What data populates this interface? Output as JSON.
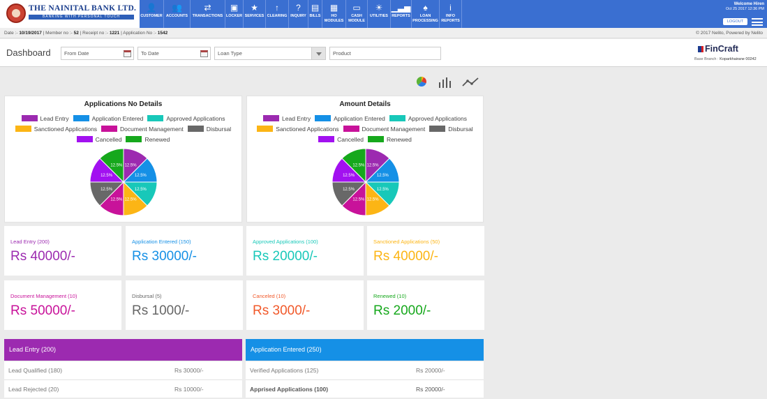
{
  "bank": {
    "name": "THE NAINITAL BANK LTD.",
    "tagline": "BANKING WITH PERSONAL TOUCH"
  },
  "nav": [
    {
      "icon": "user-icon",
      "glyph": "👤",
      "label": "CUSTOMER"
    },
    {
      "icon": "accounts-icon",
      "glyph": "👥",
      "label": "ACCOUNTS"
    },
    {
      "icon": "transfer-icon",
      "glyph": "⇄",
      "label": "TRANSACTIONS"
    },
    {
      "icon": "locker-icon",
      "glyph": "▣",
      "label": "LOCKER"
    },
    {
      "icon": "star-icon",
      "glyph": "★",
      "label": "SERVICES"
    },
    {
      "icon": "arrow-up-icon",
      "glyph": "↑",
      "label": "CLEARING"
    },
    {
      "icon": "question-icon",
      "glyph": "?",
      "label": "INQUIRY"
    },
    {
      "icon": "document-icon",
      "glyph": "▤",
      "label": "BILLS"
    },
    {
      "icon": "ho-modules-icon",
      "glyph": "▦",
      "label": "HO\nMODULES"
    },
    {
      "icon": "cash-icon",
      "glyph": "▭",
      "label": "CASH\nMODULE"
    },
    {
      "icon": "bulb-icon",
      "glyph": "☀",
      "label": "UTILITIES"
    },
    {
      "icon": "bar-chart-icon",
      "glyph": "▁▃▅",
      "label": "REPORTS"
    },
    {
      "icon": "loan-icon",
      "glyph": "♠",
      "label": "LOAN\nPROCESSING"
    },
    {
      "icon": "info-icon",
      "glyph": "i",
      "label": "INFO\nREPORTS"
    }
  ],
  "user": {
    "welcome": "Welcome Hiren",
    "datetime": "Oct 25 2017 12:36 PM",
    "logout": "LOGOUT"
  },
  "infobar": {
    "date_label": "Date :- ",
    "date": "10/19/2017",
    "member_label": " | Member no :- ",
    "member": "52",
    "receipt_label": " | Receipt no :- ",
    "receipt": "1221",
    "app_label": " | Application No :- ",
    "app": "1542",
    "copyright": "© 2017 Nelito, Powered by Nelito"
  },
  "filters": {
    "title": "Dashboard",
    "from_date": "From Date",
    "to_date": "To Date",
    "loan_type": "Loan Type",
    "product": "Product"
  },
  "brand": {
    "name": "FinCraft",
    "branch_label": "Base Branch :",
    "branch": "Koparkhairane 00242"
  },
  "legend": [
    {
      "label": "Lead Entry",
      "color": "#9c2ab0"
    },
    {
      "label": "Application Entered",
      "color": "#1590e6"
    },
    {
      "label": "Approved Applications",
      "color": "#18c8b9"
    },
    {
      "label": "Sanctioned Applications",
      "color": "#fcb515"
    },
    {
      "label": "Document Management",
      "color": "#c8129a"
    },
    {
      "label": "Disbursal",
      "color": "#686868"
    },
    {
      "label": "Cancelled",
      "color": "#a211f0"
    },
    {
      "label": "Renewed",
      "color": "#16a81c"
    }
  ],
  "charts": [
    {
      "title": "Applications No Details"
    },
    {
      "title": "Amount Details"
    }
  ],
  "chart_data": [
    {
      "type": "pie",
      "title": "Applications No Details",
      "categories": [
        "Lead Entry",
        "Application Entered",
        "Approved Applications",
        "Sanctioned Applications",
        "Document Management",
        "Disbursal",
        "Cancelled",
        "Renewed"
      ],
      "values": [
        12.5,
        12.5,
        12.5,
        12.5,
        12.5,
        12.5,
        12.5,
        12.5
      ],
      "labels": [
        "12.5%",
        "12.5%",
        "12.5%",
        "12.5%",
        "12.5%",
        "12.5%",
        "12.5%",
        "12.5%"
      ]
    },
    {
      "type": "pie",
      "title": "Amount Details",
      "categories": [
        "Lead Entry",
        "Application Entered",
        "Approved Applications",
        "Sanctioned Applications",
        "Document Management",
        "Disbursal",
        "Cancelled",
        "Renewed"
      ],
      "values": [
        12.5,
        12.5,
        12.5,
        12.5,
        12.5,
        12.5,
        12.5,
        12.5
      ],
      "labels": [
        "12.5%",
        "12.5%",
        "12.5%",
        "12.5%",
        "12.5%",
        "12.5%",
        "12.5%",
        "12.5%"
      ]
    }
  ],
  "stats": [
    {
      "label": "Lead Entry (200)",
      "value": "Rs 40000/-",
      "color": "#9c2ab0"
    },
    {
      "label": "Application Entered (150)",
      "value": "Rs 30000/-",
      "color": "#1590e6"
    },
    {
      "label": "Approved Applications (100)",
      "value": "Rs 20000/-",
      "color": "#18c8b9"
    },
    {
      "label": "Sanctioned Applications (50)",
      "value": "Rs 40000/-",
      "color": "#fcb515"
    },
    {
      "label": "Document Management (10)",
      "value": "Rs 50000/-",
      "color": "#c8129a"
    },
    {
      "label": "Disbursal (5)",
      "value": "Rs 1000/-",
      "color": "#666666"
    },
    {
      "label": "Canceled (10)",
      "value": "Rs 3000/-",
      "color": "#f1592a"
    },
    {
      "label": "Renewed (10)",
      "value": "Rs 2000/-",
      "color": "#16a81c"
    }
  ],
  "tables": [
    {
      "title": "Lead Entry (200)",
      "color": "#9c2ab0",
      "rows": [
        {
          "name": "Lead Qualified (180)",
          "value": "Rs 30000/-"
        },
        {
          "name": "Lead Rejected (20)",
          "value": "Rs 10000/-"
        }
      ]
    },
    {
      "title": "Application Entered (250)",
      "color": "#1590e6",
      "rows": [
        {
          "name": "Verified Applications (125)",
          "value": "Rs 20000/-"
        },
        {
          "name": "Apprised Applications (100)",
          "value": "Rs 20000/-"
        }
      ]
    }
  ]
}
